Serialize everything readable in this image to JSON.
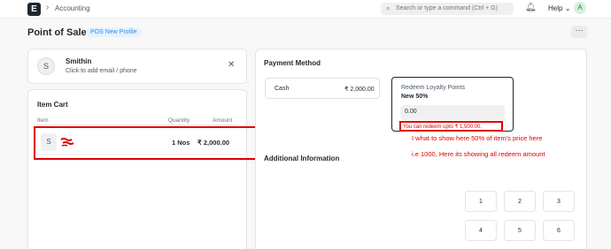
{
  "navbar": {
    "logo": "E",
    "breadcrumb": "Accounting",
    "search_placeholder": "Search or type a command (Ctrl + G)",
    "help_label": "Help",
    "user_initial": "A"
  },
  "page": {
    "title": "Point of Sale",
    "profile_badge": "POS New Profile"
  },
  "customer": {
    "initial": "S",
    "name": "Smithin",
    "subtitle": "Click to add email / phone"
  },
  "cart": {
    "title": "Item Cart",
    "columns": {
      "item": "Item",
      "quantity": "Quantity",
      "amount": "Amount"
    },
    "items": [
      {
        "initial": "S",
        "quantity": "1 Nos",
        "amount": "₹ 2,000.00"
      }
    ]
  },
  "payment": {
    "title": "Payment Method",
    "cash": {
      "label": "Cash",
      "value": "₹ 2,000.00"
    },
    "loyalty": {
      "label": "Redeem Loyalty Points",
      "program": "New 50%",
      "value": "0.00",
      "hint": "You can redeem upto ₹ 1,500.00."
    },
    "additional_title": "Additional Information",
    "keypad": [
      "1",
      "2",
      "3",
      "4",
      "5",
      "6"
    ]
  },
  "annotations": {
    "line1": "I what to show here 50% of item's price here",
    "line2": "i.e 1000, Here its showing all redeem amount"
  },
  "colors": {
    "accent": "#2490ef",
    "annotation": "#e00000"
  }
}
